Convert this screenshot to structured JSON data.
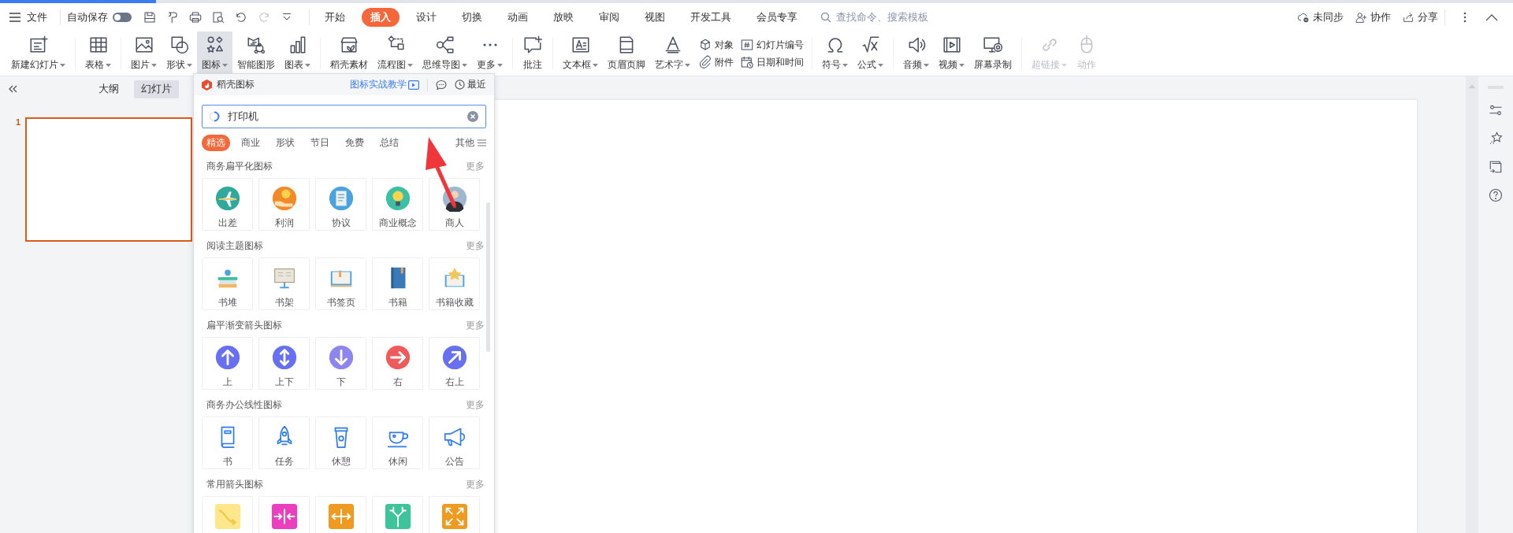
{
  "title_bar": {
    "file_menu": "文件",
    "autosave": {
      "label": "自动保存",
      "on": false
    },
    "quick_access": [
      {
        "kind": "save",
        "disabled": false
      },
      {
        "kind": "format",
        "disabled": false
      },
      {
        "kind": "print",
        "disabled": false
      },
      {
        "kind": "preview",
        "disabled": false
      },
      {
        "kind": "undo",
        "disabled": false
      },
      {
        "kind": "redo",
        "disabled": true
      },
      {
        "kind": "customize",
        "disabled": false
      }
    ],
    "tabs": [
      {
        "label": "开始",
        "selected": false
      },
      {
        "label": "插入",
        "selected": true
      },
      {
        "label": "设计",
        "selected": false
      },
      {
        "label": "切换",
        "selected": false
      },
      {
        "label": "动画",
        "selected": false
      },
      {
        "label": "放映",
        "selected": false
      },
      {
        "label": "审阅",
        "selected": false
      },
      {
        "label": "视图",
        "selected": false
      },
      {
        "label": "开发工具",
        "selected": false
      },
      {
        "label": "会员专享",
        "selected": false
      }
    ],
    "search": {
      "placeholder": "查找命令、搜索模板"
    },
    "actions": [
      {
        "kind": "cloud",
        "label": "未同步"
      },
      {
        "kind": "collab",
        "label": "协作"
      },
      {
        "kind": "share",
        "label": "分享"
      }
    ]
  },
  "ribbon": {
    "groups": [
      [
        {
          "kind": "newslide",
          "label": "新建幻灯片",
          "dropdown": true,
          "selected": false,
          "disabled": false
        }
      ],
      [
        {
          "kind": "table",
          "label": "表格",
          "dropdown": true,
          "selected": false,
          "disabled": false
        }
      ],
      [
        {
          "kind": "image",
          "label": "图片",
          "dropdown": true,
          "selected": false,
          "disabled": false
        },
        {
          "kind": "shape",
          "label": "形状",
          "dropdown": true,
          "selected": false,
          "disabled": false
        },
        {
          "kind": "icons",
          "label": "图标",
          "dropdown": true,
          "selected": true,
          "disabled": false
        },
        {
          "kind": "smartart",
          "label": "智能图形",
          "dropdown": false,
          "selected": false,
          "disabled": false
        },
        {
          "kind": "chart",
          "label": "图表",
          "dropdown": true,
          "selected": false,
          "disabled": false
        }
      ],
      [
        {
          "kind": "store",
          "label": "稻壳素材",
          "dropdown": false,
          "selected": false,
          "disabled": false
        },
        {
          "kind": "flow",
          "label": "流程图",
          "dropdown": true,
          "selected": false,
          "disabled": false
        },
        {
          "kind": "mindmap",
          "label": "思维导图",
          "dropdown": true,
          "selected": false,
          "disabled": false
        },
        {
          "kind": "more",
          "label": "更多",
          "dropdown": true,
          "selected": false,
          "disabled": false
        }
      ],
      [
        {
          "kind": "comment",
          "label": "批注",
          "dropdown": false,
          "selected": false,
          "disabled": false
        }
      ],
      [
        {
          "kind": "textbox",
          "label": "文本框",
          "dropdown": true,
          "selected": false,
          "disabled": false
        },
        {
          "kind": "header",
          "label": "页眉页脚",
          "dropdown": false,
          "selected": false,
          "disabled": false
        },
        {
          "kind": "wordart",
          "label": "艺术字",
          "dropdown": true,
          "selected": false,
          "disabled": false
        },
        {
          "kind": "stack",
          "items": [
            {
              "kind": "object",
              "label": "对象"
            },
            {
              "kind": "attach",
              "label": "附件"
            }
          ]
        },
        {
          "kind": "stack",
          "items": [
            {
              "kind": "slidenum",
              "label": "幻灯片编号"
            },
            {
              "kind": "datetime",
              "label": "日期和时间"
            }
          ]
        }
      ],
      [
        {
          "kind": "symbol",
          "label": "符号",
          "dropdown": true,
          "selected": false,
          "disabled": false
        },
        {
          "kind": "formula",
          "label": "公式",
          "dropdown": true,
          "selected": false,
          "disabled": false
        }
      ],
      [
        {
          "kind": "audio",
          "label": "音频",
          "dropdown": true,
          "selected": false,
          "disabled": false
        },
        {
          "kind": "video",
          "label": "视频",
          "dropdown": true,
          "selected": false,
          "disabled": false
        },
        {
          "kind": "record",
          "label": "屏幕录制",
          "dropdown": false,
          "selected": false,
          "disabled": false
        }
      ],
      [
        {
          "kind": "link",
          "label": "超链接",
          "dropdown": true,
          "selected": false,
          "disabled": true
        },
        {
          "kind": "action",
          "label": "动作",
          "dropdown": false,
          "selected": false,
          "disabled": true
        }
      ]
    ]
  },
  "left_pane": {
    "view_tabs": [
      {
        "label": "大纲",
        "selected": false
      },
      {
        "label": "幻灯片",
        "selected": true
      }
    ],
    "slides": [
      {
        "number": "1",
        "selected": true
      }
    ]
  },
  "icon_panel": {
    "brand": "稻壳图标",
    "tutorial_link": "图标实战教学",
    "recent": "最近",
    "search": {
      "value": "打印机"
    },
    "categories": [
      {
        "label": "精选",
        "selected": true
      },
      {
        "label": "商业",
        "selected": false
      },
      {
        "label": "形状",
        "selected": false
      },
      {
        "label": "节日",
        "selected": false
      },
      {
        "label": "免费",
        "selected": false
      },
      {
        "label": "总结",
        "selected": false
      }
    ],
    "other": "其他",
    "sections": [
      {
        "title": "商务扁平化图标",
        "more": "更多",
        "tiles": [
          {
            "kind": "plane",
            "label": "出差"
          },
          {
            "kind": "coin",
            "label": "利润"
          },
          {
            "kind": "scroll",
            "label": "协议"
          },
          {
            "kind": "bulb",
            "label": "商业概念"
          },
          {
            "kind": "person",
            "label": "商人"
          }
        ]
      },
      {
        "title": "阅读主题图标",
        "more": "更多",
        "tiles": [
          {
            "kind": "bookstack",
            "label": "书堆"
          },
          {
            "kind": "easel",
            "label": "书架"
          },
          {
            "kind": "openbook",
            "label": "书签页"
          },
          {
            "kind": "book",
            "label": "书籍"
          },
          {
            "kind": "starbook",
            "label": "书籍收藏"
          }
        ]
      },
      {
        "title": "扁平渐变箭头图标",
        "more": "更多",
        "tiles": [
          {
            "kind": "up",
            "label": "上"
          },
          {
            "kind": "updown",
            "label": "上下"
          },
          {
            "kind": "down",
            "label": "下"
          },
          {
            "kind": "right",
            "label": "右"
          },
          {
            "kind": "upright",
            "label": "右上"
          }
        ]
      },
      {
        "title": "商务办公线性图标",
        "more": "更多",
        "tiles": [
          {
            "kind": "linebook",
            "label": "书"
          },
          {
            "kind": "rocket",
            "label": "任务"
          },
          {
            "kind": "cup",
            "label": "休憩"
          },
          {
            "kind": "teacup",
            "label": "休闲"
          },
          {
            "kind": "megaphone",
            "label": "公告"
          }
        ]
      },
      {
        "title": "常用箭头图标",
        "more": "更多",
        "tiles": [
          {
            "kind": "curve"
          },
          {
            "kind": "inward"
          },
          {
            "kind": "outward"
          },
          {
            "kind": "fork"
          },
          {
            "kind": "expand"
          }
        ]
      }
    ]
  }
}
